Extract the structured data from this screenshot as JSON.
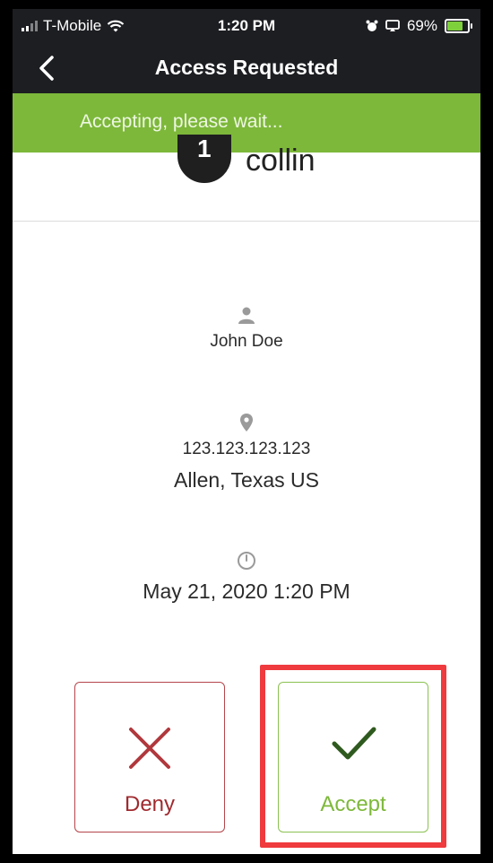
{
  "status_bar": {
    "carrier": "T-Mobile",
    "time": "1:20 PM",
    "battery_percent": "69%",
    "battery_level": 0.69
  },
  "nav": {
    "title": "Access Requested",
    "back_icon": "chevron-left-icon"
  },
  "banner": {
    "text": "Accepting, please wait...",
    "color": "#7db83a"
  },
  "account": {
    "badge": "1",
    "name": "collin"
  },
  "request": {
    "user_name": "John Doe",
    "ip_address": "123.123.123.123",
    "location": "Allen, Texas US",
    "datetime": "May 21, 2020 1:20 PM"
  },
  "actions": {
    "deny_label": "Deny",
    "accept_label": "Accept",
    "deny_color": "#9f2a2f",
    "accept_color": "#7db83a"
  },
  "highlight_color": "#ef3a3e"
}
